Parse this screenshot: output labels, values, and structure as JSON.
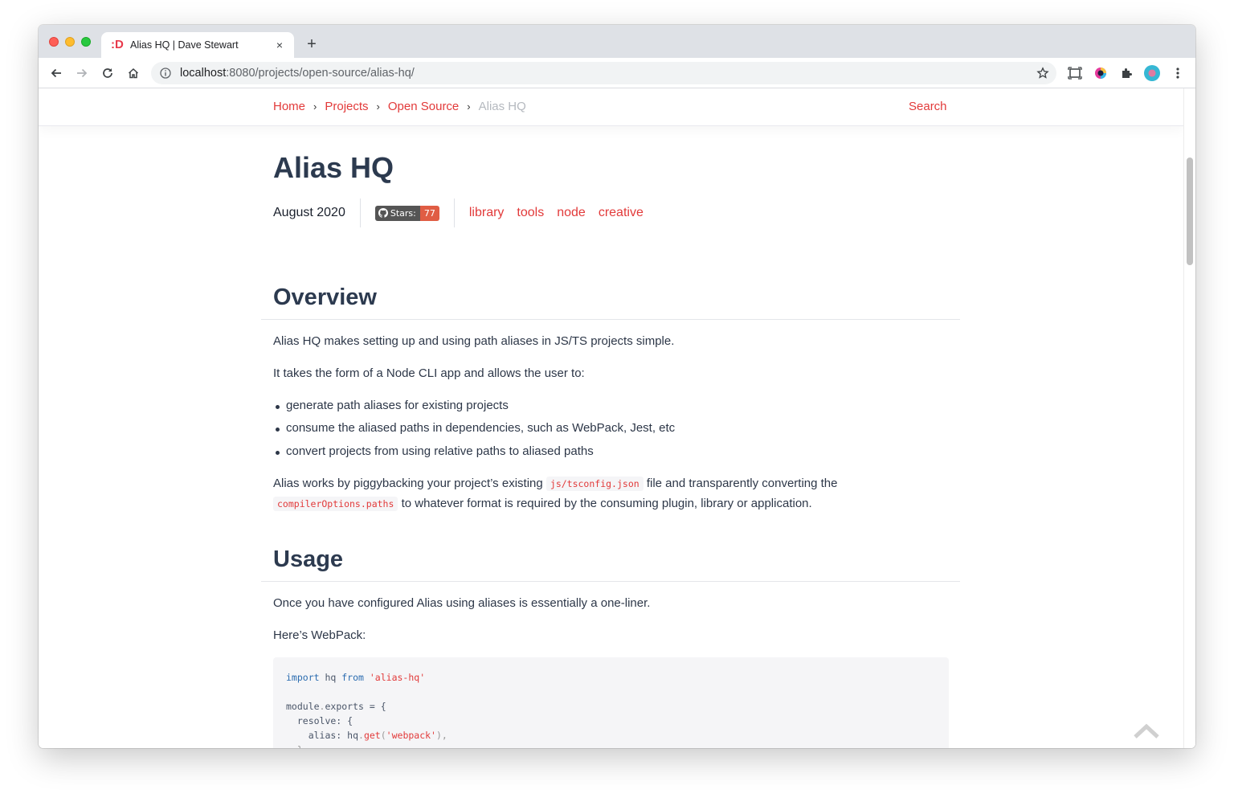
{
  "browser": {
    "tab_title": "Alias HQ | Dave Stewart",
    "tab_favicon": ":D",
    "new_tab": "+",
    "close": "×",
    "url_host": "localhost",
    "url_rest": ":8080/projects/open-source/alias-hq/"
  },
  "header": {
    "breadcrumbs": [
      "Home",
      "Projects",
      "Open Source"
    ],
    "current": "Alias HQ",
    "separator": "›",
    "search": "Search"
  },
  "page": {
    "title": "Alias HQ",
    "date": "August 2020",
    "badge_label": "Stars:",
    "badge_count": "77",
    "tags": [
      "library",
      "tools",
      "node",
      "creative"
    ]
  },
  "overview": {
    "heading": "Overview",
    "p1": "Alias HQ makes setting up and using path aliases in JS/TS projects simple.",
    "p2": "It takes the form of a Node CLI app and allows the user to:",
    "bullets": [
      "generate path aliases for existing projects",
      "consume the aliased paths in dependencies, such as WebPack, Jest, etc",
      "convert projects from using relative paths to aliased paths"
    ],
    "p3_a": "Alias works by piggybacking your project’s existing ",
    "p3_code": "js/tsconfig.json",
    "p3_b": " file and transparently converting the",
    "p4_code": "compilerOptions.paths",
    "p4_b": " to whatever format is required by the consuming plugin, library or application."
  },
  "usage": {
    "heading": "Usage",
    "p1": "Once you have configured Alias using aliases is essentially a one-liner.",
    "p2": "Here’s WebPack:",
    "code": {
      "l1_kw1": "import",
      "l1_mid": " hq ",
      "l1_kw2": "from",
      "l1_str": " 'alias-hq'",
      "l3": "module",
      "l3_dot": ".",
      "l3_b": "exports = {",
      "l4": "  resolve: {",
      "l5_a": "    alias: hq",
      "l5_dot": ".",
      "l5_fn": "get",
      "l5_p1": "(",
      "l5_str": "'webpack'",
      "l5_p2": "),",
      "l6": "  },",
      "l7": "}"
    }
  }
}
